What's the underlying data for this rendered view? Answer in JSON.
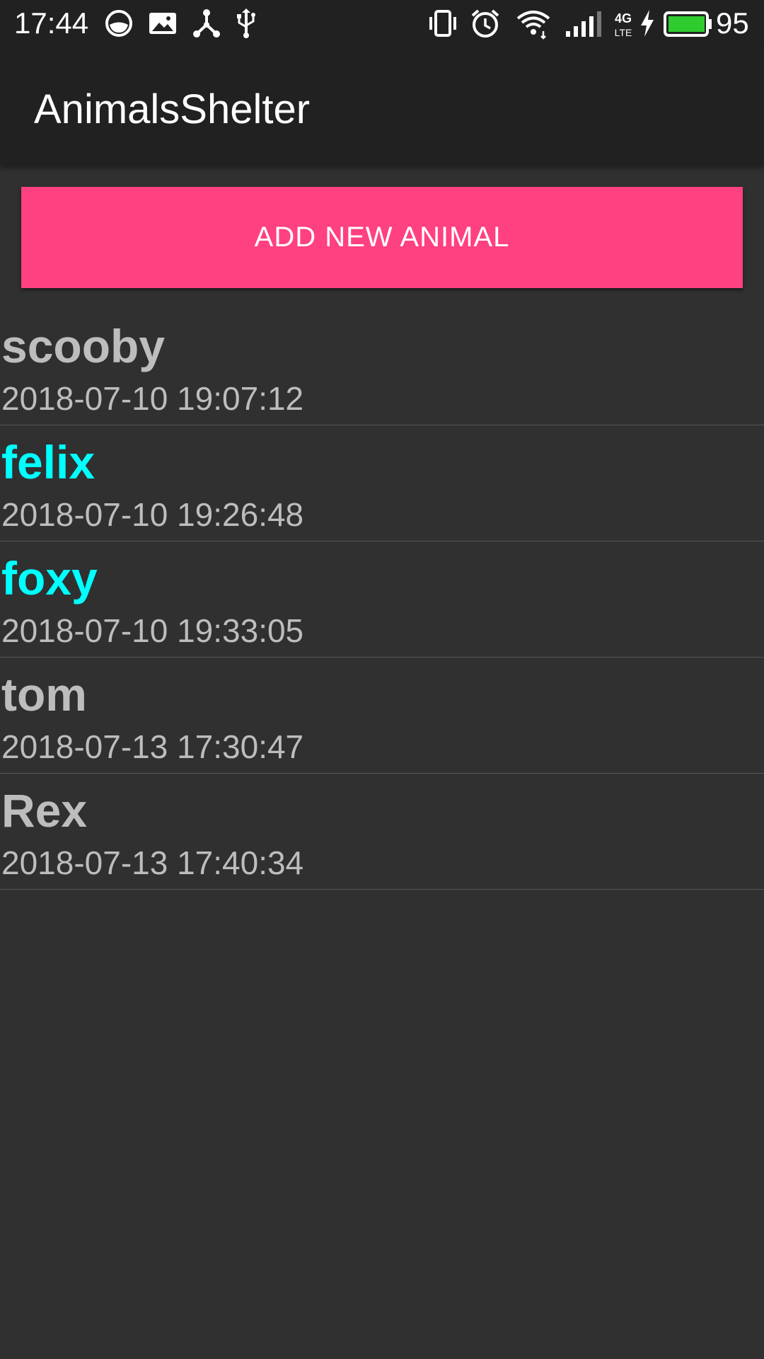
{
  "status_bar": {
    "time": "17:44",
    "battery_level": "95",
    "network_label": "4G LTE",
    "battery_color": "#2ecc2e",
    "icons_left": [
      "face-icon",
      "image-icon",
      "network-hub-icon",
      "usb-icon"
    ],
    "icons_right": [
      "vibrate-icon",
      "alarm-icon",
      "wifi-icon",
      "signal-icon",
      "network-type-icon",
      "charging-icon",
      "battery-icon"
    ]
  },
  "app_bar": {
    "title": "AnimalsShelter",
    "background": "#212121"
  },
  "add_button": {
    "label": "ADD NEW ANIMAL",
    "color": "#ff4081"
  },
  "animals": [
    {
      "name": "scooby",
      "date": "2018-07-10 19:07:12",
      "name_color": "#bdbdbd"
    },
    {
      "name": "felix",
      "date": "2018-07-10 19:26:48",
      "name_color": "#00ffff"
    },
    {
      "name": "foxy",
      "date": "2018-07-10 19:33:05",
      "name_color": "#00ffff"
    },
    {
      "name": "tom",
      "date": "2018-07-13 17:30:47",
      "name_color": "#bdbdbd"
    },
    {
      "name": "Rex",
      "date": "2018-07-13 17:40:34",
      "name_color": "#bdbdbd"
    }
  ]
}
